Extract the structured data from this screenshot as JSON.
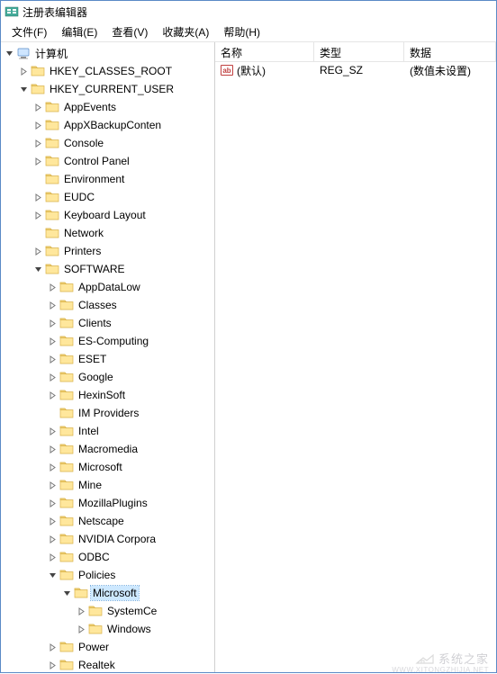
{
  "window": {
    "title": "注册表编辑器"
  },
  "menu": {
    "file": "文件(F)",
    "edit": "编辑(E)",
    "view": "查看(V)",
    "favorites": "收藏夹(A)",
    "help": "帮助(H)"
  },
  "tree": [
    {
      "label": "计算机",
      "depth": 0,
      "expanded": true,
      "icon": "computer",
      "hasChildren": true
    },
    {
      "label": "HKEY_CLASSES_ROOT",
      "depth": 1,
      "expanded": false,
      "icon": "folder",
      "hasChildren": true
    },
    {
      "label": "HKEY_CURRENT_USER",
      "depth": 1,
      "expanded": true,
      "icon": "folder",
      "hasChildren": true
    },
    {
      "label": "AppEvents",
      "depth": 2,
      "expanded": false,
      "icon": "folder",
      "hasChildren": true
    },
    {
      "label": "AppXBackupConten",
      "depth": 2,
      "expanded": false,
      "icon": "folder",
      "hasChildren": true
    },
    {
      "label": "Console",
      "depth": 2,
      "expanded": false,
      "icon": "folder",
      "hasChildren": true
    },
    {
      "label": "Control Panel",
      "depth": 2,
      "expanded": false,
      "icon": "folder",
      "hasChildren": true
    },
    {
      "label": "Environment",
      "depth": 2,
      "expanded": false,
      "icon": "folder",
      "hasChildren": false
    },
    {
      "label": "EUDC",
      "depth": 2,
      "expanded": false,
      "icon": "folder",
      "hasChildren": true
    },
    {
      "label": "Keyboard Layout",
      "depth": 2,
      "expanded": false,
      "icon": "folder",
      "hasChildren": true
    },
    {
      "label": "Network",
      "depth": 2,
      "expanded": false,
      "icon": "folder",
      "hasChildren": false
    },
    {
      "label": "Printers",
      "depth": 2,
      "expanded": false,
      "icon": "folder",
      "hasChildren": true
    },
    {
      "label": "SOFTWARE",
      "depth": 2,
      "expanded": true,
      "icon": "folder",
      "hasChildren": true
    },
    {
      "label": "AppDataLow",
      "depth": 3,
      "expanded": false,
      "icon": "folder",
      "hasChildren": true
    },
    {
      "label": "Classes",
      "depth": 3,
      "expanded": false,
      "icon": "folder",
      "hasChildren": true
    },
    {
      "label": "Clients",
      "depth": 3,
      "expanded": false,
      "icon": "folder",
      "hasChildren": true
    },
    {
      "label": "ES-Computing",
      "depth": 3,
      "expanded": false,
      "icon": "folder",
      "hasChildren": true
    },
    {
      "label": "ESET",
      "depth": 3,
      "expanded": false,
      "icon": "folder",
      "hasChildren": true
    },
    {
      "label": "Google",
      "depth": 3,
      "expanded": false,
      "icon": "folder",
      "hasChildren": true
    },
    {
      "label": "HexinSoft",
      "depth": 3,
      "expanded": false,
      "icon": "folder",
      "hasChildren": true
    },
    {
      "label": "IM Providers",
      "depth": 3,
      "expanded": false,
      "icon": "folder",
      "hasChildren": false
    },
    {
      "label": "Intel",
      "depth": 3,
      "expanded": false,
      "icon": "folder",
      "hasChildren": true
    },
    {
      "label": "Macromedia",
      "depth": 3,
      "expanded": false,
      "icon": "folder",
      "hasChildren": true
    },
    {
      "label": "Microsoft",
      "depth": 3,
      "expanded": false,
      "icon": "folder",
      "hasChildren": true
    },
    {
      "label": "Mine",
      "depth": 3,
      "expanded": false,
      "icon": "folder",
      "hasChildren": true
    },
    {
      "label": "MozillaPlugins",
      "depth": 3,
      "expanded": false,
      "icon": "folder",
      "hasChildren": true
    },
    {
      "label": "Netscape",
      "depth": 3,
      "expanded": false,
      "icon": "folder",
      "hasChildren": true
    },
    {
      "label": "NVIDIA Corpora",
      "depth": 3,
      "expanded": false,
      "icon": "folder",
      "hasChildren": true
    },
    {
      "label": "ODBC",
      "depth": 3,
      "expanded": false,
      "icon": "folder",
      "hasChildren": true
    },
    {
      "label": "Policies",
      "depth": 3,
      "expanded": true,
      "icon": "folder",
      "hasChildren": true
    },
    {
      "label": "Microsoft",
      "depth": 4,
      "expanded": true,
      "icon": "folder",
      "hasChildren": true,
      "selected": true
    },
    {
      "label": "SystemCe",
      "depth": 5,
      "expanded": false,
      "icon": "folder",
      "hasChildren": true
    },
    {
      "label": "Windows",
      "depth": 5,
      "expanded": false,
      "icon": "folder",
      "hasChildren": true
    },
    {
      "label": "Power",
      "depth": 3,
      "expanded": false,
      "icon": "folder",
      "hasChildren": true
    },
    {
      "label": "Realtek",
      "depth": 3,
      "expanded": false,
      "icon": "folder",
      "hasChildren": true
    }
  ],
  "list": {
    "headers": {
      "name": "名称",
      "type": "类型",
      "data": "数据"
    },
    "rows": [
      {
        "name": "(默认)",
        "type": "REG_SZ",
        "data": "(数值未设置)"
      }
    ]
  },
  "watermark": {
    "text": "系统之家",
    "sub": "WWW.XITONGZHIJIA.NET"
  }
}
